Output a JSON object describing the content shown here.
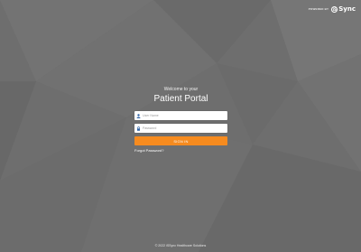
{
  "brand": {
    "powered_by": "POWERED BY",
    "logo_text": "Sync",
    "logo_mark": "iS"
  },
  "portal": {
    "welcome": "Welcome to your",
    "title": "Patient Portal",
    "username": {
      "placeholder": "User Name",
      "value": "",
      "icon": "user-icon"
    },
    "password": {
      "placeholder": "Password",
      "value": "",
      "icon": "lock-icon"
    },
    "signin_label": "SIGN IN",
    "forgot_label": "Forgot Password?"
  },
  "footer": {
    "text": "© 2022 iSSync Healthcare Solutions"
  },
  "colors": {
    "background": "#6e6e6e",
    "accent": "#f68b1f",
    "icon": "#2f63a6"
  }
}
